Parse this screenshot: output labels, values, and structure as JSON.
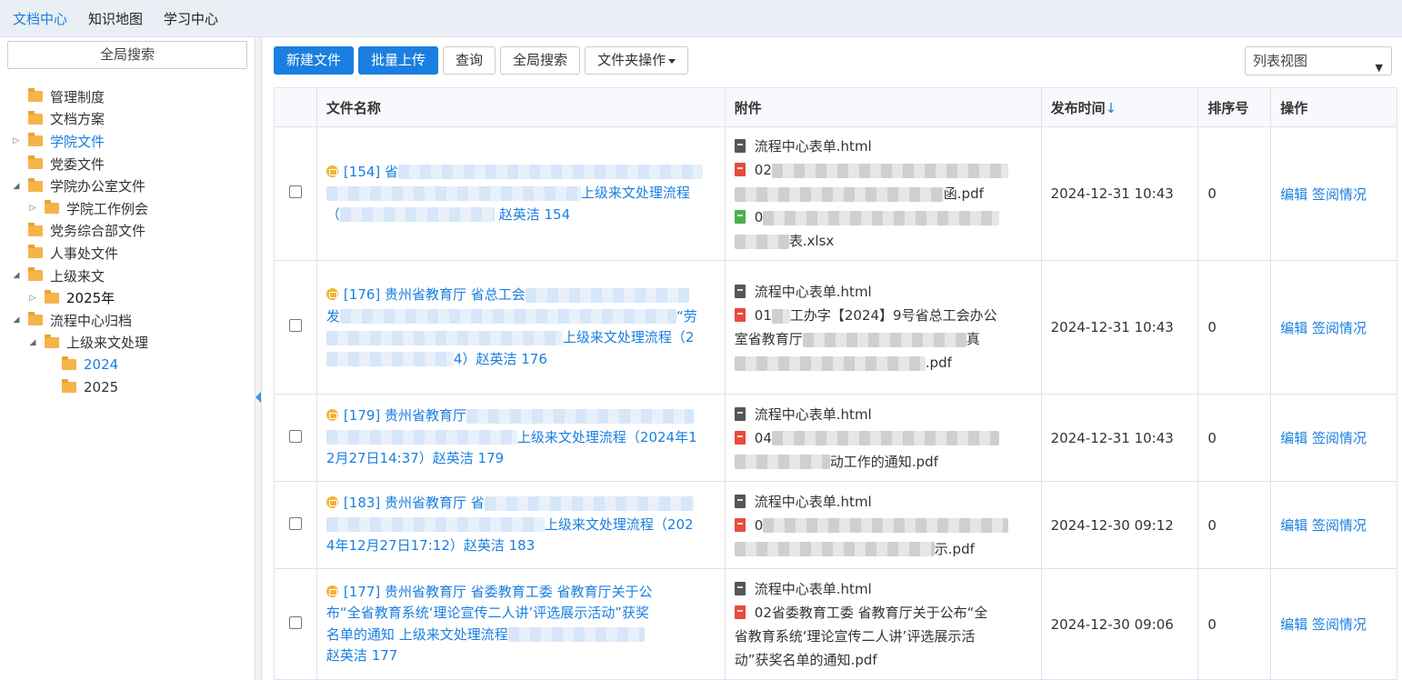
{
  "topnav": {
    "items": [
      {
        "label": "文档中心",
        "active": true
      },
      {
        "label": "知识地图",
        "active": false
      },
      {
        "label": "学习中心",
        "active": false
      }
    ]
  },
  "sidebar": {
    "search_label": "全局搜索",
    "tree": [
      {
        "label": "管理制度"
      },
      {
        "label": "文档方案"
      },
      {
        "label": "学院文件"
      },
      {
        "label": "党委文件"
      },
      {
        "label": "学院办公室文件"
      },
      {
        "label": "学院工作例会"
      },
      {
        "label": "党务综合部文件"
      },
      {
        "label": "人事处文件"
      },
      {
        "label": "上级来文"
      },
      {
        "label": "2025年"
      },
      {
        "label": "流程中心归档"
      },
      {
        "label": "上级来文处理"
      },
      {
        "label": "2024"
      },
      {
        "label": "2025"
      }
    ]
  },
  "toolbar": {
    "new_file": "新建文件",
    "batch_upload": "批量上传",
    "query": "查询",
    "global_search": "全局搜索",
    "folder_ops": "文件夹操作",
    "view_mode": "列表视图"
  },
  "table": {
    "headers": {
      "name": "文件名称",
      "attachments": "附件",
      "publish_time": "发布时间",
      "sort_arrow": "↓",
      "sort_no": "排序号",
      "ops": "操作"
    },
    "rows": [
      {
        "name_lines": [
          "[154] 省",
          "上级来文处理流程",
          "（",
          "赵英洁 154"
        ],
        "attachments": [
          {
            "type": "html",
            "lines": [
              "流程中心表单.html"
            ]
          },
          {
            "type": "pdf",
            "lines": [
              "02",
              "函.pdf"
            ]
          },
          {
            "type": "xlsx",
            "lines": [
              "0",
              "表.xlsx"
            ]
          }
        ],
        "time": "2024-12-31 10:43",
        "sort": "0",
        "edit": "编辑",
        "read": "签阅情况"
      },
      {
        "name_lines": [
          "[176] 贵州省教育厅 省总工会",
          "发",
          "“劳",
          "上级来文处理流程（2",
          "4）赵英洁 176"
        ],
        "attachments": [
          {
            "type": "html",
            "lines": [
              "流程中心表单.html"
            ]
          },
          {
            "type": "pdf",
            "lines": [
              "01",
              "工办字【2024】9号省总工会办公",
              "室省教育厅",
              "真",
              ".pdf"
            ]
          }
        ],
        "time": "2024-12-31 10:43",
        "sort": "0",
        "edit": "编辑",
        "read": "签阅情况"
      },
      {
        "name_lines": [
          "[179] 贵州省教育厅",
          "上级来文处理流程（2024年1",
          "2月27日14:37）赵英洁 179"
        ],
        "attachments": [
          {
            "type": "html",
            "lines": [
              "流程中心表单.html"
            ]
          },
          {
            "type": "pdf",
            "lines": [
              "04",
              "动工作的通知.pdf"
            ]
          }
        ],
        "time": "2024-12-31 10:43",
        "sort": "0",
        "edit": "编辑",
        "read": "签阅情况"
      },
      {
        "name_lines": [
          "[183] 贵州省教育厅 省",
          "上级来文处理流程（202",
          "4年12月27日17:12）赵英洁 183"
        ],
        "attachments": [
          {
            "type": "html",
            "lines": [
              "流程中心表单.html"
            ]
          },
          {
            "type": "pdf",
            "lines": [
              "0",
              "示.pdf"
            ]
          }
        ],
        "time": "2024-12-30 09:12",
        "sort": "0",
        "edit": "编辑",
        "read": "签阅情况"
      },
      {
        "name_lines": [
          "[177] 贵州省教育厅 省委教育工委 省教育厅关于公",
          "布“全省教育系统‘理论宣传二人讲’评选展示活动”获奖",
          "名单的通知 上级来文处理流程",
          "赵英洁 177"
        ],
        "attachments": [
          {
            "type": "html",
            "lines": [
              "流程中心表单.html"
            ]
          },
          {
            "type": "pdf",
            "lines": [
              "02省委教育工委 省教育厅关于公布“全",
              "省教育系统‘理论宣传二人讲’评选展示活",
              "动”获奖名单的通知.pdf"
            ]
          }
        ],
        "time": "2024-12-30 09:06",
        "sort": "0",
        "edit": "编辑",
        "read": "签阅情况"
      }
    ]
  }
}
